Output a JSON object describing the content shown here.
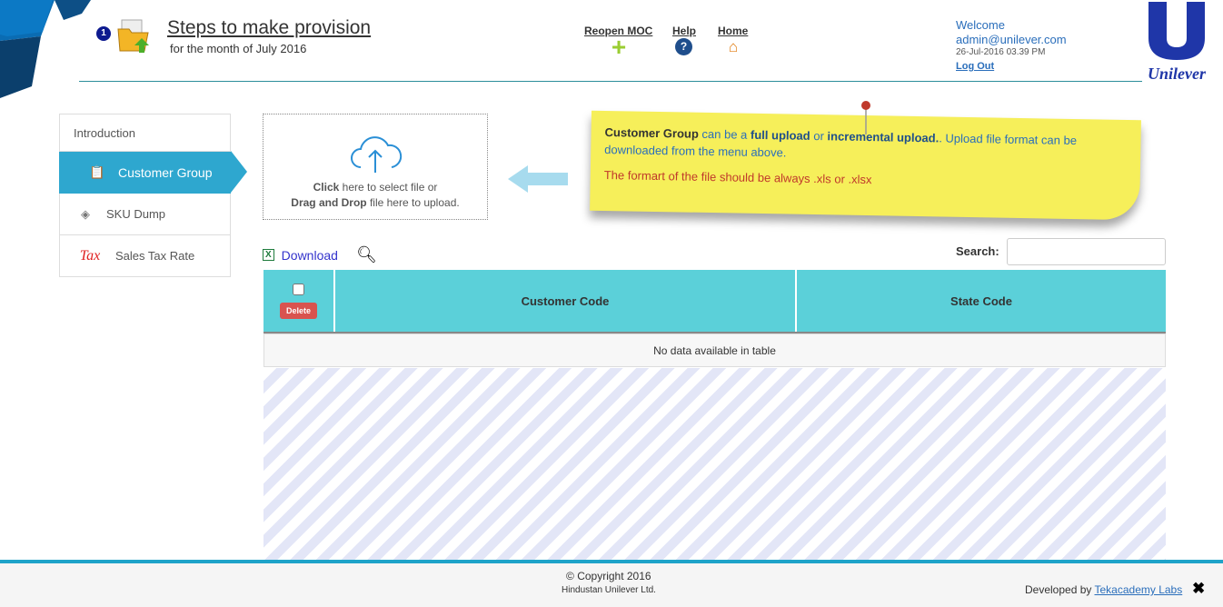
{
  "header": {
    "step_badge": "1",
    "title": "Steps to make provision",
    "subtitle": "for the month of July 2016",
    "nav": [
      {
        "label": "Reopen MOC",
        "icon": "plus-icon"
      },
      {
        "label": "Help",
        "icon": "help-icon"
      },
      {
        "label": "Home",
        "icon": "home-icon"
      }
    ],
    "welcome": "Welcome",
    "user": "admin@unilever.com",
    "timestamp": "26-Jul-2016 03.39 PM",
    "logout": "Log Out",
    "logo_text": "Unilever"
  },
  "sidebar": {
    "items": [
      {
        "label": "Introduction"
      },
      {
        "label": "Customer Group",
        "active": true
      },
      {
        "label": "SKU Dump"
      },
      {
        "label": "Sales Tax Rate",
        "icon_text": "Tax"
      }
    ]
  },
  "upload": {
    "click": "Click",
    "click_rest": " here to select file or",
    "drag": "Drag and Drop",
    "drag_rest": " file here to upload."
  },
  "note": {
    "p1": "Customer Group",
    "p2": " can be a ",
    "p3": "full upload",
    "p4": " or ",
    "p5": "incremental upload.",
    "p6": ". Upload file format can be downloaded from the menu above.",
    "warn": "The formart of the file should be always .xls or .xlsx"
  },
  "toolbar": {
    "download": "Download",
    "search_label": "Search:",
    "search_value": ""
  },
  "table": {
    "delete": "Delete",
    "columns": [
      "Customer Code",
      "State Code"
    ],
    "empty": "No data available in table"
  },
  "footer": {
    "copyright": "Copyright 2016",
    "company": "Hindustan Unilever Ltd.",
    "dev_prefix": "Developed by ",
    "dev_link": "Tekacademy Labs"
  }
}
